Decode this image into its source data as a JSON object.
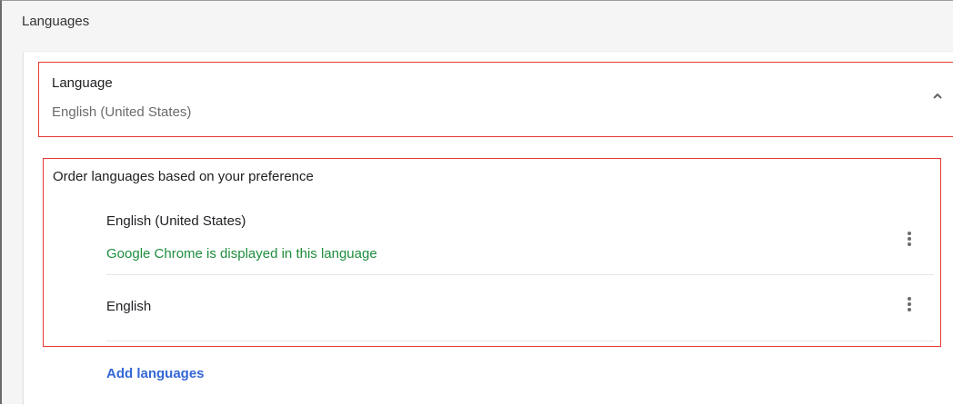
{
  "section": {
    "title": "Languages"
  },
  "language_header": {
    "title": "Language",
    "subtitle": "English (United States)",
    "chevron_icon": "chevron-up-icon"
  },
  "preference": {
    "title": "Order languages based on your preference",
    "languages": [
      {
        "name": "English (United States)",
        "note": "Google Chrome is displayed in this language",
        "menu_icon": "more-vert-icon"
      },
      {
        "name": "English",
        "note": "",
        "menu_icon": "more-vert-icon"
      }
    ]
  },
  "add_languages_label": "Add languages",
  "colors": {
    "accent_link": "#3367d6",
    "note_green": "#1e8e3e",
    "highlight_red": "#e53935"
  }
}
